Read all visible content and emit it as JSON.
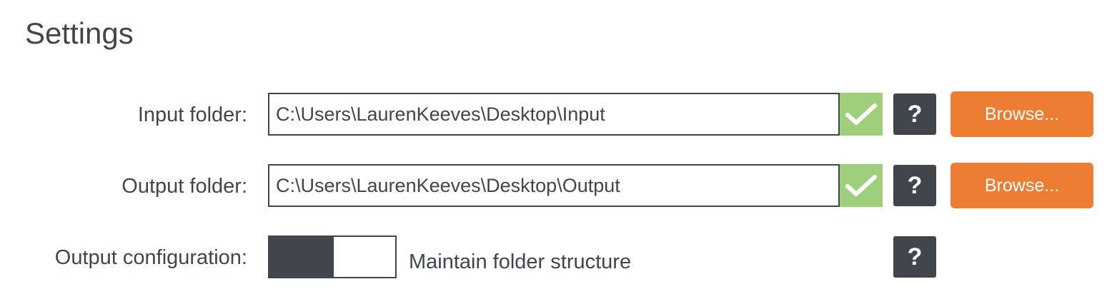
{
  "page_title": "Settings",
  "input_folder": {
    "label": "Input folder:",
    "value": "C:\\Users\\LaurenKeeves\\Desktop\\Input",
    "valid": true,
    "help_label": "?",
    "browse_label": "Browse..."
  },
  "output_folder": {
    "label": "Output folder:",
    "value": "C:\\Users\\LaurenKeeves\\Desktop\\Output",
    "valid": true,
    "help_label": "?",
    "browse_label": "Browse..."
  },
  "output_configuration": {
    "label": "Output configuration:",
    "toggle_state": "on",
    "toggle_text": "Maintain folder structure",
    "help_label": "?"
  },
  "colors": {
    "text": "#41464c",
    "valid_check": "#9fcf7a",
    "browse_button": "#ec7d32",
    "help_button": "#41464c"
  },
  "icons": {
    "valid": "checkmark-icon",
    "help": "question-mark-icon"
  }
}
